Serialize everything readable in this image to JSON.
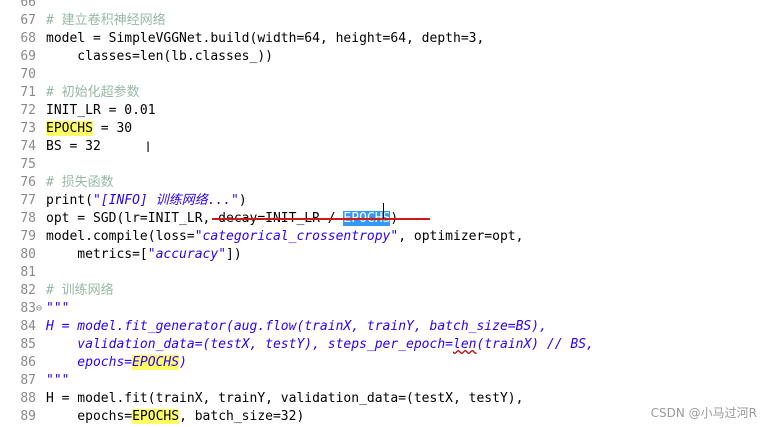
{
  "editor": {
    "lines": [
      {
        "n": "66",
        "fold": "",
        "html": ""
      },
      {
        "n": "67",
        "fold": "",
        "html": "<span class=\"cmt\"># 建立卷积神经网络</span>"
      },
      {
        "n": "68",
        "fold": "",
        "html": "model = SimpleVGGNet.build(width=64, height=64, depth=3,"
      },
      {
        "n": "69",
        "fold": "",
        "html": "    classes=len(lb.classes_))"
      },
      {
        "n": "70",
        "fold": "",
        "html": ""
      },
      {
        "n": "71",
        "fold": "",
        "html": "<span class=\"cmt\"># 初始化超参数</span>"
      },
      {
        "n": "72",
        "fold": "",
        "html": "INIT_LR = 0.01"
      },
      {
        "n": "73",
        "fold": "",
        "html": "<span class=\"hl-yellow\">EPOCHS</span> = 30"
      },
      {
        "n": "74",
        "fold": "",
        "html": "BS = 32"
      },
      {
        "n": "75",
        "fold": "",
        "html": ""
      },
      {
        "n": "76",
        "fold": "",
        "html": "<span class=\"cmt\"># 损失函数</span>"
      },
      {
        "n": "77",
        "fold": "",
        "html": "print(<span class=\"str\">\"[INFO] 训练网络...\"</span>)"
      },
      {
        "n": "78",
        "fold": "",
        "html": "opt = SGD(lr=INIT_LR, decay=INIT_LR / <span class=\"hl-sel\">EPOCHS</span>)"
      },
      {
        "n": "79",
        "fold": "",
        "html": "model.compile(loss=<span class=\"str\">\"categorical_crossentropy\"</span>, optimizer=opt,"
      },
      {
        "n": "80",
        "fold": "",
        "html": "    metrics=[<span class=\"str\">\"accuracy\"</span>])"
      },
      {
        "n": "81",
        "fold": "",
        "html": ""
      },
      {
        "n": "82",
        "fold": "",
        "html": "<span class=\"cmt\"># 训练网络</span>"
      },
      {
        "n": "83",
        "fold": "⊖",
        "html": "<span class=\"doc\">\"\"\"</span>"
      },
      {
        "n": "84",
        "fold": "",
        "html": "<span class=\"doc\">H = model.fit_generator(aug.flow(trainX, trainY, batch_size=BS),</span>"
      },
      {
        "n": "85",
        "fold": "",
        "html": "<span class=\"doc\">    validation_data=(testX, testY), steps_per_epoch=<span class=\"underline\">len</span>(trainX) // BS,</span>"
      },
      {
        "n": "86",
        "fold": "",
        "html": "<span class=\"doc\">    epochs=<span class=\"hl-yellow\">EPOCHS</span>)</span>"
      },
      {
        "n": "87",
        "fold": "",
        "html": "<span class=\"doc\">\"\"\"</span>"
      },
      {
        "n": "88",
        "fold": "",
        "html": "H = model.fit(trainX, trainY, validation_data=(testX, testY),"
      },
      {
        "n": "89",
        "fold": "",
        "html": "    epochs=<span class=\"hl-yellow\">EPOCHS</span>, batch_size=32)"
      }
    ]
  },
  "watermark": "CSDN @小马过河R",
  "colors": {
    "comment": "#3f7f5f",
    "string": "#2a00ff",
    "selection": "#3399ff",
    "occurrence": "#ffff66",
    "annotation_line": "#d01818"
  }
}
